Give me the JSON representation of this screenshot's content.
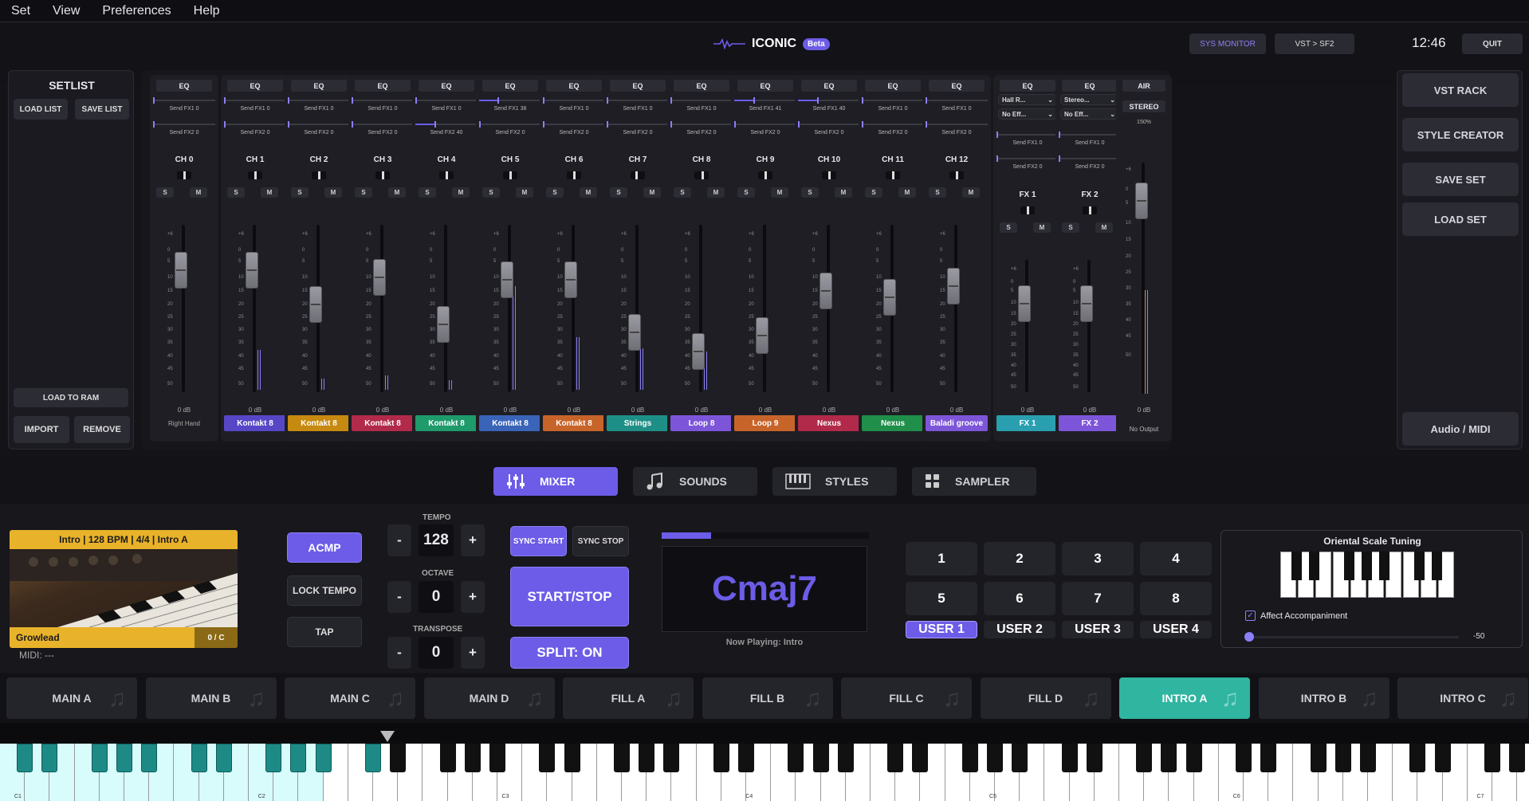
{
  "menu": [
    "Set",
    "View",
    "Preferences",
    "Help"
  ],
  "app": {
    "name": "ICONIC",
    "badge": "Beta",
    "sys_monitor": "SYS MONITOR",
    "vst_sf2": "VST > SF2",
    "clock": "12:46",
    "quit": "QUIT"
  },
  "setlist": {
    "title": "SETLIST",
    "load_list": "LOAD LIST",
    "save_list": "SAVE LIST",
    "load_to_ram": "LOAD TO RAM",
    "import": "IMPORT",
    "remove": "REMOVE"
  },
  "channels": [
    {
      "eq": "EQ",
      "fx1": "Send FX1 0",
      "fx2": "Send FX2 0",
      "name": "CH 0",
      "db": "0 dB",
      "inst": "Right Hand",
      "color": "",
      "fx1v": 0,
      "fx2v": 0,
      "fader": 0.2,
      "pan": 0.5
    },
    {
      "eq": "EQ",
      "fx1": "Send FX1 0",
      "fx2": "Send FX2 0",
      "name": "CH 1",
      "db": "0 dB",
      "inst": "Kontakt 8",
      "color": "#5747c7",
      "fx1v": 0,
      "fx2v": 0,
      "fader": 0.2,
      "pan": 0.5
    },
    {
      "eq": "EQ",
      "fx1": "Send FX1 0",
      "fx2": "Send FX2 0",
      "name": "CH 2",
      "db": "0 dB",
      "inst": "Kontakt 8",
      "color": "#c68a10",
      "fx1v": 0,
      "fx2v": 0,
      "fader": 0.45,
      "pan": 0.5
    },
    {
      "eq": "EQ",
      "fx1": "Send FX1 0",
      "fx2": "Send FX2 0",
      "name": "CH 3",
      "db": "0 dB",
      "inst": "Kontakt 8",
      "color": "#b22a4a",
      "fx1v": 0,
      "fx2v": 0,
      "fader": 0.25,
      "pan": 0.5
    },
    {
      "eq": "EQ",
      "fx1": "Send FX1 0",
      "fx2": "Send FX2 40",
      "name": "CH 4",
      "db": "0 dB",
      "inst": "Kontakt 8",
      "color": "#1f9a6b",
      "fx1v": 0,
      "fx2v": 0.31,
      "fader": 0.6,
      "pan": 0.5
    },
    {
      "eq": "EQ",
      "fx1": "Send FX1 38",
      "fx2": "Send FX2 0",
      "name": "CH 5",
      "db": "0 dB",
      "inst": "Kontakt 8",
      "color": "#3a64b8",
      "fx1v": 0.3,
      "fx2v": 0,
      "fader": 0.27,
      "pan": 0.5
    },
    {
      "eq": "EQ",
      "fx1": "Send FX1 0",
      "fx2": "Send FX2 0",
      "name": "CH 6",
      "db": "0 dB",
      "inst": "Kontakt 8",
      "color": "#c7642a",
      "fx1v": 0,
      "fx2v": 0,
      "fader": 0.27,
      "pan": 0.5
    },
    {
      "eq": "EQ",
      "fx1": "Send FX1 0",
      "fx2": "Send FX2 0",
      "name": "CH 7",
      "db": "0 dB",
      "inst": "Strings",
      "color": "#1e8f86",
      "fx1v": 0,
      "fx2v": 0,
      "fader": 0.66,
      "pan": 0.4
    },
    {
      "eq": "EQ",
      "fx1": "Send FX1 0",
      "fx2": "Send FX2 0",
      "name": "CH 8",
      "db": "0 dB",
      "inst": "Loop 8",
      "color": "#7d55d8",
      "fx1v": 0,
      "fx2v": 0,
      "fader": 0.8,
      "pan": 0.6
    },
    {
      "eq": "EQ",
      "fx1": "Send FX1 41",
      "fx2": "Send FX2 0",
      "name": "CH 9",
      "db": "0 dB",
      "inst": "Loop 9",
      "color": "#c7642a",
      "fx1v": 0.32,
      "fx2v": 0,
      "fader": 0.68,
      "pan": 0.5
    },
    {
      "eq": "EQ",
      "fx1": "Send FX1 40",
      "fx2": "Send FX2 0",
      "name": "CH 10",
      "db": "0 dB",
      "inst": "Nexus",
      "color": "#b22a4a",
      "fx1v": 0.31,
      "fx2v": 0,
      "fader": 0.35,
      "pan": 0.5
    },
    {
      "eq": "EQ",
      "fx1": "Send FX1 0",
      "fx2": "Send FX2 0",
      "name": "CH 11",
      "db": "0 dB",
      "inst": "Nexus",
      "color": "#1f8f4a",
      "fx1v": 0,
      "fx2v": 0,
      "fader": 0.4,
      "pan": 0.5
    },
    {
      "eq": "EQ",
      "fx1": "Send FX1 0",
      "fx2": "Send FX2 0",
      "name": "CH 12",
      "db": "0 dB",
      "inst": "Baladi groove",
      "color": "#7d55d8",
      "fx1v": 0,
      "fx2v": 0,
      "fader": 0.32,
      "pan": 0.5
    }
  ],
  "fx": [
    {
      "eq": "EQ",
      "sel1": "Hall R...",
      "sel2": "No Eff...",
      "fx1": "Send FX1 0",
      "fx2": "Send FX2 0",
      "name": "FX 1",
      "db": "0 dB",
      "label": "FX 1",
      "color": "#2a9fb0",
      "fader": 0.25
    },
    {
      "eq": "EQ",
      "sel1": "Stereo...",
      "sel2": "No Eff...",
      "fx1": "Send FX1 0",
      "fx2": "Send FX2 0",
      "name": "FX 2",
      "db": "0 dB",
      "label": "FX 2",
      "color": "#7d55d8",
      "fader": 0.25
    }
  ],
  "master": {
    "air": "AIR",
    "stereo": "STEREO",
    "pct": "150%",
    "db": "0 dB",
    "out": "No Output",
    "fader": 0.1
  },
  "scale": [
    "+6",
    "0",
    "5",
    "10",
    "15",
    "20",
    "25",
    "30",
    "35",
    "40",
    "45",
    "50"
  ],
  "rack": {
    "vst_rack": "VST RACK",
    "style_creator": "STYLE CREATOR",
    "save_set": "SAVE SET",
    "load_set": "LOAD SET",
    "audio_midi": "Audio / MIDI"
  },
  "tabs": [
    {
      "label": "MIXER",
      "icon": "sliders-icon"
    },
    {
      "label": "SOUNDS",
      "icon": "music-note-icon"
    },
    {
      "label": "STYLES",
      "icon": "piano-icon"
    },
    {
      "label": "SAMPLER",
      "icon": "grid-icon"
    }
  ],
  "sound": {
    "header": "Intro  |  128 BPM  |  4/4  |  Intro A",
    "name": "Growlead",
    "oc": "0 / C",
    "midi": "MIDI: ---"
  },
  "perf": {
    "acmp": "ACMP",
    "lock_tempo": "LOCK TEMPO",
    "tap": "TAP",
    "tempo_label": "TEMPO",
    "tempo": "128",
    "octave_label": "OCTAVE",
    "octave": "0",
    "transpose_label": "TRANSPOSE",
    "transpose": "0",
    "minus": "-",
    "plus": "+",
    "sync_start": "SYNC START",
    "sync_stop": "SYNC STOP",
    "start_stop": "START/STOP",
    "split": "SPLIT: ON"
  },
  "chord": {
    "value": "Cmaj7",
    "now_playing": "Now Playing: Intro",
    "progress": 0.24
  },
  "variations": [
    "1",
    "2",
    "3",
    "4",
    "5",
    "6",
    "7",
    "8"
  ],
  "users": [
    "USER 1",
    "USER 2",
    "USER 3",
    "USER 4"
  ],
  "oriental": {
    "title": "Oriental Scale Tuning",
    "affect": "Affect Accompaniment",
    "value": "-50",
    "check": "✓"
  },
  "styles": [
    "MAIN A",
    "MAIN B",
    "MAIN C",
    "MAIN D",
    "FILL A",
    "FILL B",
    "FILL C",
    "FILL D",
    "INTRO A",
    "INTRO B",
    "INTRO C"
  ],
  "keyboard": {
    "labels": [
      "C1",
      "C2",
      "C3",
      "C4",
      "C5",
      "C6",
      "C7"
    ]
  },
  "colors": {
    "accent": "#6c5ce7",
    "teal": "#2fb5a0",
    "gold": "#e8b32a"
  }
}
